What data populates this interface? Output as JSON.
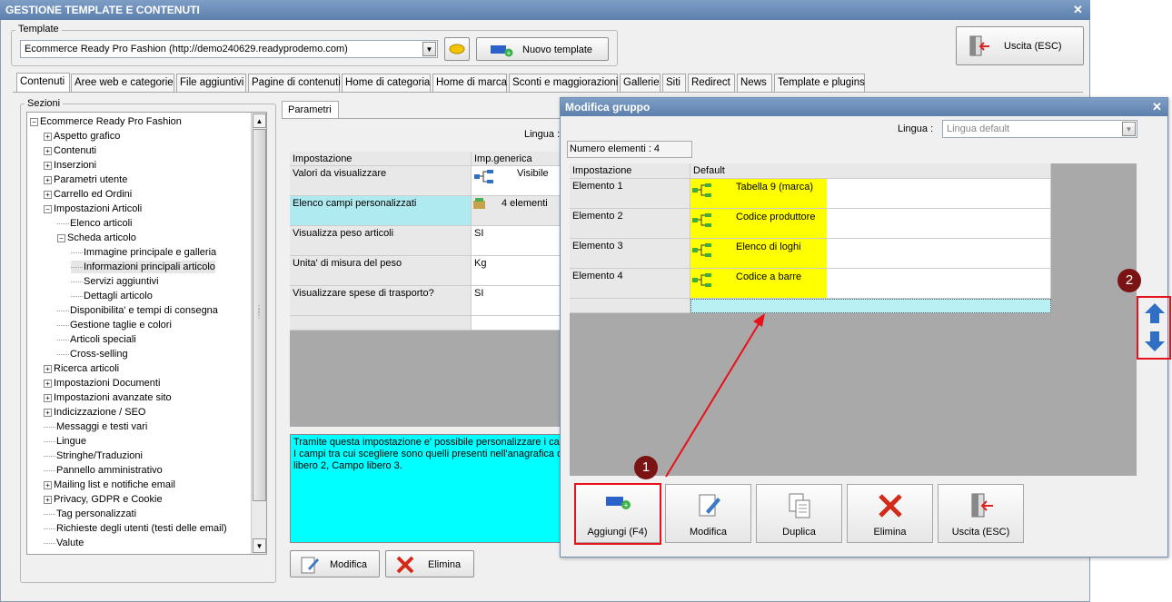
{
  "main": {
    "title": "GESTIONE TEMPLATE E CONTENUTI",
    "template_label": "Template",
    "template_value": "Ecommerce Ready Pro Fashion (http://demo240629.readyprodemo.com)",
    "new_template_label": "Nuovo template",
    "exit_label": "Uscita (ESC)",
    "tabs": [
      "Contenuti",
      "Aree web e categorie",
      "File aggiuntivi",
      "Pagine di contenuti",
      "Home di categoria",
      "Home di marca",
      "Sconti e maggiorazioni",
      "Gallerie",
      "Siti",
      "Redirect",
      "News",
      "Template e plugins"
    ],
    "sections_label": "Sezioni",
    "tree": [
      {
        "label": "Ecommerce Ready Pro Fashion",
        "level": 0,
        "expand": "minus"
      },
      {
        "label": "Aspetto grafico",
        "level": 1,
        "expand": "plus"
      },
      {
        "label": "Contenuti",
        "level": 1,
        "expand": "plus"
      },
      {
        "label": "Inserzioni",
        "level": 1,
        "expand": "plus"
      },
      {
        "label": "Parametri utente",
        "level": 1,
        "expand": "plus"
      },
      {
        "label": "Carrello ed Ordini",
        "level": 1,
        "expand": "plus"
      },
      {
        "label": "Impostazioni Articoli",
        "level": 1,
        "expand": "minus"
      },
      {
        "label": "Elenco articoli",
        "level": 2,
        "expand": ""
      },
      {
        "label": "Scheda articolo",
        "level": 2,
        "expand": "minus"
      },
      {
        "label": "Immagine principale e galleria",
        "level": 3,
        "expand": ""
      },
      {
        "label": "Informazioni principali articolo",
        "level": 3,
        "expand": "",
        "selected": true
      },
      {
        "label": "Servizi aggiuntivi",
        "level": 3,
        "expand": ""
      },
      {
        "label": "Dettagli articolo",
        "level": 3,
        "expand": ""
      },
      {
        "label": "Disponibilita' e tempi di consegna",
        "level": 2,
        "expand": ""
      },
      {
        "label": "Gestione taglie e colori",
        "level": 2,
        "expand": ""
      },
      {
        "label": "Articoli speciali",
        "level": 2,
        "expand": ""
      },
      {
        "label": "Cross-selling",
        "level": 2,
        "expand": ""
      },
      {
        "label": "Ricerca articoli",
        "level": 1,
        "expand": "plus"
      },
      {
        "label": "Impostazioni Documenti",
        "level": 1,
        "expand": "plus"
      },
      {
        "label": "Impostazioni avanzate sito",
        "level": 1,
        "expand": "plus"
      },
      {
        "label": "Indicizzazione / SEO",
        "level": 1,
        "expand": "plus"
      },
      {
        "label": "Messaggi e testi vari",
        "level": 1,
        "expand": ""
      },
      {
        "label": "Lingue",
        "level": 1,
        "expand": ""
      },
      {
        "label": "Stringhe/Traduzioni",
        "level": 1,
        "expand": ""
      },
      {
        "label": "Pannello amministrativo",
        "level": 1,
        "expand": ""
      },
      {
        "label": "Mailing list e notifiche email",
        "level": 1,
        "expand": "plus"
      },
      {
        "label": "Privacy, GDPR e Cookie",
        "level": 1,
        "expand": "plus"
      },
      {
        "label": "Tag personalizzati",
        "level": 1,
        "expand": ""
      },
      {
        "label": "Richieste degli utenti (testi delle email)",
        "level": 1,
        "expand": ""
      },
      {
        "label": "Valute",
        "level": 1,
        "expand": ""
      }
    ],
    "params_tab": "Parametri",
    "lingua_label": "Lingua :",
    "grid": {
      "col1": "Impostazione",
      "col2": "Imp.generica",
      "rows": [
        {
          "name": "Valori da visualizzare",
          "value": "Visibile"
        },
        {
          "name": "Elenco campi personalizzati",
          "value": "4 elementi"
        },
        {
          "name": "Visualizza peso articoli",
          "value": "SI"
        },
        {
          "name": "Unita' di misura del peso",
          "value": "Kg"
        },
        {
          "name": "Visualizzare spese di trasporto?",
          "value": "SI"
        }
      ]
    },
    "description_lines": [
      "Tramite questa impostazione e' possibile personalizzare i camp",
      "I campi tra cui scegliere sono quelli presenti nell'anagrafica del",
      "libero 2, Campo libero 3."
    ],
    "modify_label": "Modifica",
    "delete_label": "Elimina"
  },
  "dialog": {
    "title": "Modifica gruppo",
    "lingua_label": "Lingua :",
    "lingua_value": "Lingua default",
    "count_label": "Numero elementi : 4",
    "col1": "Impostazione",
    "col2": "Default",
    "rows": [
      {
        "name": "Elemento 1",
        "value": "Tabella 9 (marca)"
      },
      {
        "name": "Elemento 2",
        "value": "Codice produttore"
      },
      {
        "name": "Elemento 3",
        "value": "Elenco di loghi"
      },
      {
        "name": "Elemento 4",
        "value": "Codice a barre"
      }
    ],
    "buttons": [
      "Aggiungi (F4)",
      "Modifica",
      "Duplica",
      "Elimina",
      "Uscita (ESC)"
    ]
  },
  "markers": [
    "1",
    "2"
  ],
  "colors": {
    "highlight_cyan": "#00ffff",
    "yellow": "#ffff00",
    "red": "#e8101a",
    "marker": "#7a1414"
  }
}
